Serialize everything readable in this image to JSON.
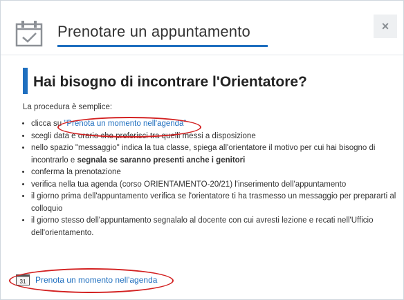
{
  "dialog": {
    "title": "Prenotare un appuntamento",
    "close_label": "×"
  },
  "section": {
    "heading": "Hai bisogno di incontrare l'Orientatore?",
    "intro": "La procedura è semplice:"
  },
  "steps": {
    "s1_prefix": "clicca su ",
    "s1_link": "\"Prenota un momento nell'agenda\"",
    "s2": "scegli data e orario che preferisci tra quelli messi a disposizione",
    "s3_text": "nello spazio \"messaggio\" indica la tua classe, spiega all'orientatore il motivo per cui hai bisogno di incontrarlo e ",
    "s3_bold": "segnala se saranno presenti anche i genitori",
    "s4": "conferma la prenotazione",
    "s5": "verifica nella tua agenda (corso ORIENTAMENTO-20/21) l'inserimento dell'appuntamento",
    "s6": "il giorno prima dell'appuntamento verifica se l'orientatore ti ha trasmesso un messaggio per prepararti al colloquio",
    "s7": "il giorno stesso dell'appuntamento segnalalo al docente con cui avresti lezione e recati nell'Ufficio dell'orientamento."
  },
  "bottom_link": {
    "icon_text": "31",
    "label": "Prenota un momento nell'agenda"
  },
  "colors": {
    "accent": "#1f6fbf",
    "highlight_oval": "#d32121"
  }
}
